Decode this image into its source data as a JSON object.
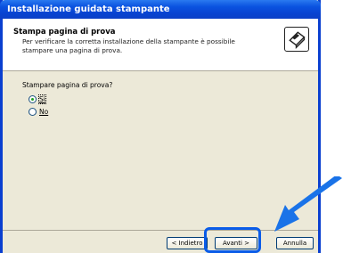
{
  "window": {
    "title": "Installazione guidata stampante"
  },
  "header": {
    "title": "Stampa pagina di prova",
    "description": "Per verificare la corretta installazione della stampante è possibile stampare una pagina di prova.",
    "icon": "printer-icon"
  },
  "content": {
    "question": "Stampare pagina di prova?",
    "options": [
      {
        "label": "Sì",
        "selected": true
      },
      {
        "label": "No",
        "selected": false
      }
    ]
  },
  "buttons": {
    "back_label": "< Indietro",
    "next_label": "Avanti >",
    "cancel_label": "Annulla"
  },
  "colors": {
    "title_bar": "#0b53e0",
    "highlight": "#0a5ce8",
    "arrow": "#1a73e8"
  }
}
